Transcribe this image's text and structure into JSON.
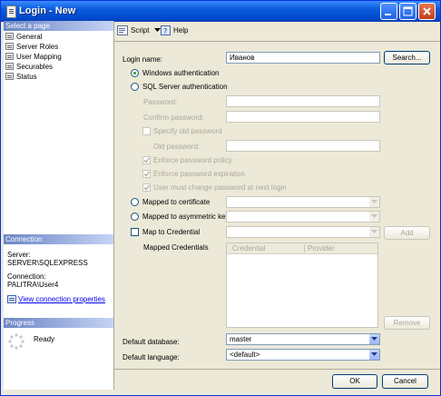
{
  "window": {
    "title": "Login - New"
  },
  "sidebar": {
    "select_page_header": "Select a page",
    "pages": [
      {
        "label": "General",
        "selected": true
      },
      {
        "label": "Server Roles"
      },
      {
        "label": "User Mapping"
      },
      {
        "label": "Securables"
      },
      {
        "label": "Status"
      }
    ],
    "connection_header": "Connection",
    "server_label": "Server:",
    "server_value": "SERVER\\SQLEXPRESS",
    "connection_label": "Connection:",
    "connection_value": "PALITRA\\User4",
    "view_connection_link": "View connection properties",
    "progress_header": "Progress",
    "progress_status": "Ready"
  },
  "toolbar": {
    "script_label": "Script",
    "help_label": "Help"
  },
  "form": {
    "login_name_label": "Login name:",
    "login_name_value": "Иванов",
    "search_button": "Search...",
    "windows_auth_label": "Windows authentication",
    "windows_auth_selected": true,
    "sql_auth_label": "SQL Server authentication",
    "password_label": "Password:",
    "confirm_password_label": "Confirm password:",
    "specify_old_password_label": "Specify old password",
    "old_password_label": "Old password:",
    "enforce_policy_label": "Enforce password policy",
    "enforce_expiration_label": "Enforce password expiration",
    "must_change_label": "User must change password at next login",
    "mapped_certificate_label": "Mapped to certificate",
    "mapped_asym_key_label": "Mapped to asymmetric key",
    "map_credential_label": "Map to Credential",
    "add_button": "Add",
    "mapped_credentials_label": "Mapped Credentials",
    "credentials_columns": [
      "Credential",
      "Provider"
    ],
    "remove_button": "Remove",
    "default_database_label": "Default database:",
    "default_database_value": "master",
    "default_language_label": "Default language:",
    "default_language_value": "<default>"
  },
  "footer": {
    "ok_button": "OK",
    "cancel_button": "Cancel"
  },
  "colors": {
    "title_bar": "#0a5bdc",
    "dialog_bg": "#ece9d8",
    "link": "#0000ee",
    "disabled_text": "#aca899"
  }
}
